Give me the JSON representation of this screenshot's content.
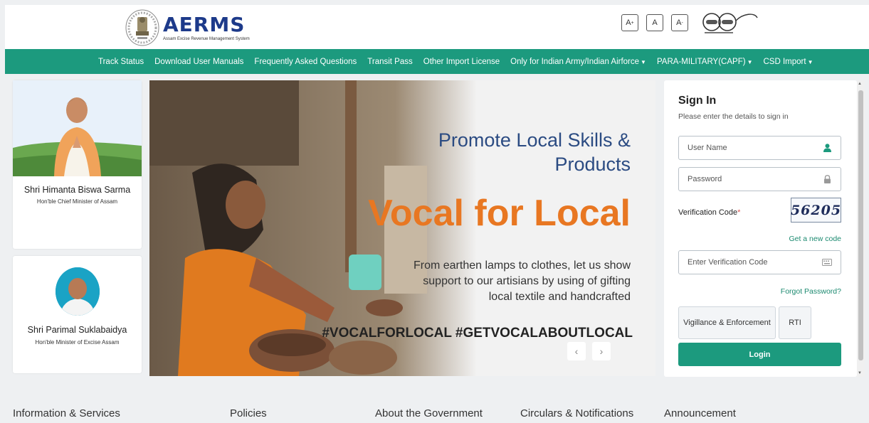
{
  "header": {
    "logo_word": "AERMS",
    "logo_sub": "Assam Excise Revenue Management System",
    "font_size_buttons": [
      "A+",
      "A",
      "A-"
    ]
  },
  "nav": {
    "items": [
      {
        "label": "Track Status",
        "dropdown": false
      },
      {
        "label": "Download User Manuals",
        "dropdown": false
      },
      {
        "label": "Frequently Asked Questions",
        "dropdown": false
      },
      {
        "label": "Transit Pass",
        "dropdown": false
      },
      {
        "label": "Other Import License",
        "dropdown": false
      },
      {
        "label": "Only for Indian Army/Indian Airforce",
        "dropdown": true
      },
      {
        "label": "PARA-MILITARY(CAPF)",
        "dropdown": true
      },
      {
        "label": "CSD Import",
        "dropdown": true
      }
    ]
  },
  "cards": {
    "cm": {
      "name": "Shri Himanta Biswa Sarma",
      "role": "Hon'ble Chief Minister of Assam"
    },
    "minister": {
      "name": "Shri Parimal Suklabaidya",
      "role": "Hon'ble Minister of Excise Assam"
    }
  },
  "banner": {
    "headline": "Promote Local Skills & Products",
    "big_text": "Vocal for Local",
    "body": "From earthen lamps to clothes, let us show support to our artisians by using of gifting local textile and handcrafted",
    "hashtags": "#VOCALFORLOCAL #GETVOCALABOUTLOCAL",
    "prev": "‹",
    "next": "›"
  },
  "signin": {
    "title": "Sign In",
    "subtitle": "Please enter the details to sign in",
    "username_placeholder": "User Name",
    "password_placeholder": "Password",
    "verification_label": "Verification Code",
    "required_mark": "*",
    "captcha": "56205",
    "new_code_link": "Get a new code",
    "code_placeholder": "Enter Verification Code",
    "forgot_link": "Forgot Password?",
    "vigilance_label": "Vigillance & Enforcement",
    "rti_label": "RTI",
    "login_label": "Login"
  },
  "footer": {
    "links": [
      "Information & Services",
      "Policies",
      "About the Government",
      "Circulars & Notifications",
      "Announcement"
    ]
  },
  "colors": {
    "brand_green": "#1c9a7e",
    "logo_blue": "#1d3a8a",
    "banner_orange": "#e87722",
    "banner_blue": "#2b4b82"
  }
}
